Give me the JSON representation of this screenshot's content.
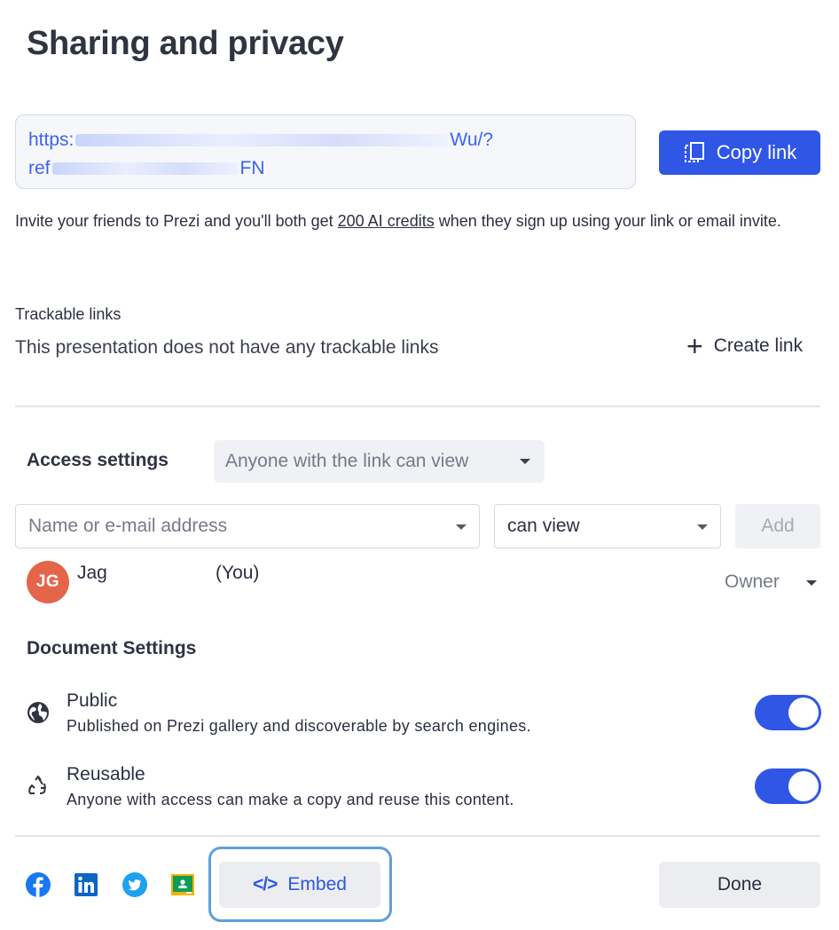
{
  "title": "Sharing and privacy",
  "share_link": {
    "line1_start": "https:",
    "line1_end": "Wu/?",
    "line2_start": "ref",
    "line2_end": "FN"
  },
  "copy_button": "Copy link",
  "invite": {
    "before": "Invite your friends to Prezi and you'll both get ",
    "credits": "200 AI credits",
    "after": " when they sign up using your link or email invite."
  },
  "trackable": {
    "label": "Trackable links",
    "empty_text": "This presentation does not have any trackable links",
    "create_label": "Create link",
    "create_icon": "+"
  },
  "access": {
    "label": "Access settings",
    "selected": "Anyone with the link can view"
  },
  "invite_form": {
    "name_placeholder": "Name or e-mail address",
    "permission": "can view",
    "add_label": "Add"
  },
  "user": {
    "initials": "JG",
    "name": "Jag",
    "you": "(You)",
    "role": "Owner",
    "avatar_color": "#e5654a"
  },
  "document_settings": {
    "label": "Document Settings",
    "items": [
      {
        "icon": "globe-icon",
        "title": "Public",
        "description": "Published on Prezi gallery and discoverable by search engines.",
        "enabled": true
      },
      {
        "icon": "recycle-icon",
        "title": "Reusable",
        "description": "Anyone with access can make a copy and reuse this content.",
        "enabled": true
      }
    ]
  },
  "footer": {
    "socials": [
      "facebook-icon",
      "linkedin-icon",
      "twitter-icon",
      "google-classroom-icon"
    ],
    "embed_label": "Embed",
    "embed_icon": "</>",
    "done_label": "Done"
  },
  "colors": {
    "accent": "#2f56e5",
    "link": "#3d63f5",
    "focus_ring": "#5ea0d9"
  }
}
